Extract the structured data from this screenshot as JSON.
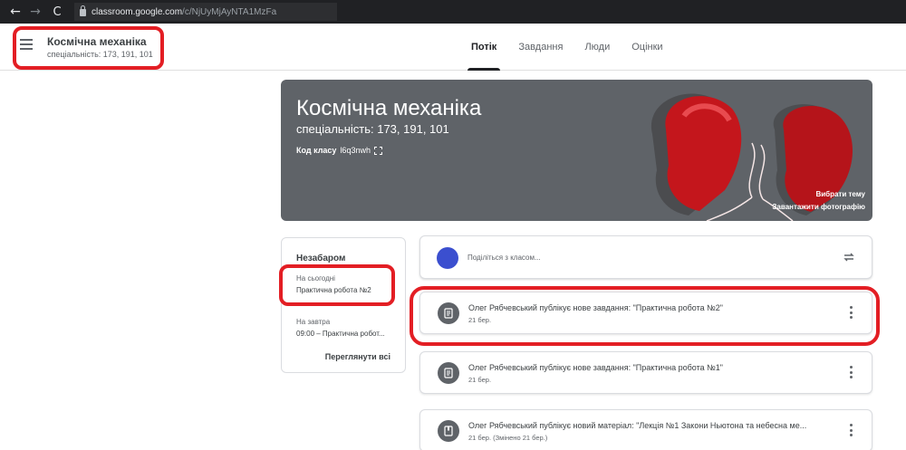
{
  "browser": {
    "url_host": "classroom.google.com",
    "url_path": "/c/NjUyMjAyNTA1MzFa"
  },
  "header": {
    "title": "Космічна механіка",
    "subtitle": "спеціальність: 173, 191, 101",
    "tabs": [
      {
        "label": "Потік",
        "active": true
      },
      {
        "label": "Завдання",
        "active": false
      },
      {
        "label": "Люди",
        "active": false
      },
      {
        "label": "Оцінки",
        "active": false
      }
    ]
  },
  "banner": {
    "title": "Космічна механіка",
    "subtitle": "спеціальність: 173, 191, 101",
    "class_code_label": "Код класу",
    "class_code": "l6q3nwh",
    "select_theme": "Вибрати тему",
    "upload_photo": "Завантажити фотографію"
  },
  "upcoming": {
    "title": "Незабаром",
    "today_label": "На сьогодні",
    "today_item": "Практична робота №2",
    "tomorrow_label": "На завтра",
    "tomorrow_item": "09:00 – Практична робот...",
    "view_all": "Переглянути всі"
  },
  "share": {
    "placeholder": "Поділіться з класом..."
  },
  "posts": [
    {
      "title": "Олег Рябчевський публікує нове завдання: \"Практична робота №2\"",
      "date": "21 бер."
    },
    {
      "title": "Олег Рябчевський публікує нове завдання: \"Практична робота №1\"",
      "date": "21 бер."
    },
    {
      "title": "Олег Рябчевський публікує новий матеріал: \"Лекція №1 Закони Ньютона та небесна ме...",
      "date": "21 бер. (Змінено 21 бер.)"
    }
  ],
  "colors": {
    "banner": "#5f6368",
    "avatar": "#3b4fcf",
    "highlight": "#e31e24"
  }
}
